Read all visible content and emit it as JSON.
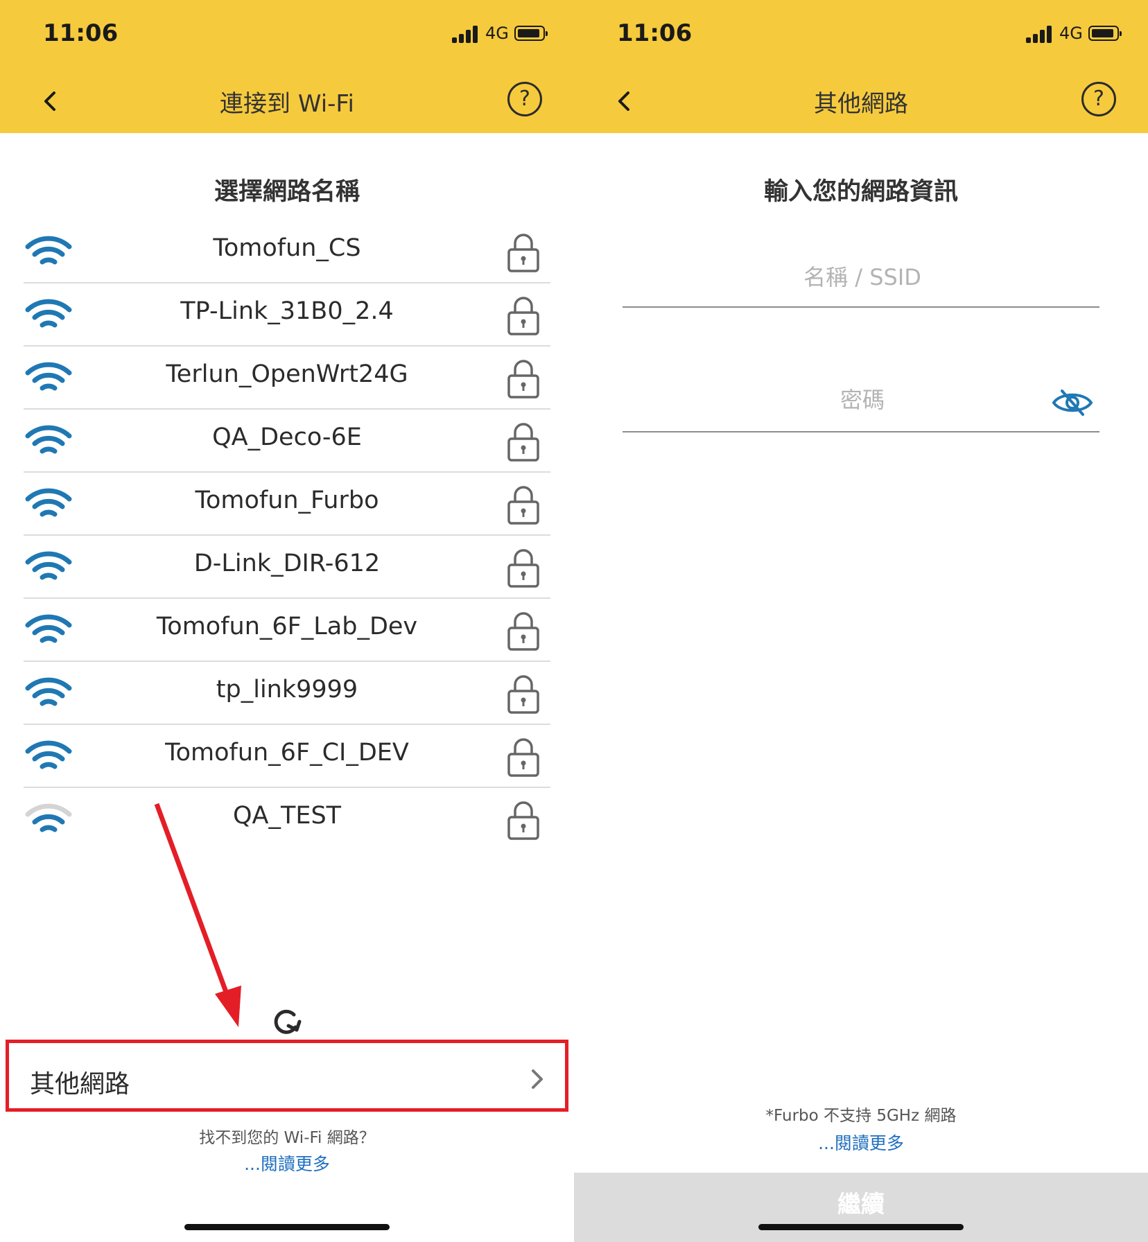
{
  "left": {
    "status": {
      "time": "11:06",
      "network": "4G"
    },
    "nav": {
      "title": "連接到 Wi-Fi",
      "help_label": "?"
    },
    "subtitle": "選擇網路名稱",
    "networks": [
      {
        "name": "Tomofun_CS",
        "signal": "strong",
        "locked": true
      },
      {
        "name": "TP-Link_31B0_2.4",
        "signal": "strong",
        "locked": true
      },
      {
        "name": "Terlun_OpenWrt24G",
        "signal": "strong",
        "locked": true
      },
      {
        "name": "QA_Deco-6E",
        "signal": "strong",
        "locked": true
      },
      {
        "name": "Tomofun_Furbo",
        "signal": "strong",
        "locked": true
      },
      {
        "name": "D-Link_DIR-612",
        "signal": "strong",
        "locked": true
      },
      {
        "name": "Tomofun_6F_Lab_Dev",
        "signal": "strong",
        "locked": true
      },
      {
        "name": "tp_link9999",
        "signal": "strong",
        "locked": true
      },
      {
        "name": "Tomofun_6F_CI_DEV",
        "signal": "strong",
        "locked": true
      },
      {
        "name": "QA_TEST",
        "signal": "medium",
        "locked": true
      }
    ],
    "other_network": "其他網路",
    "hint": "找不到您的 Wi-Fi 網路？",
    "read_more": "...閱讀更多"
  },
  "right": {
    "status": {
      "time": "11:06",
      "network": "4G"
    },
    "nav": {
      "title": "其他網路",
      "help_label": "?"
    },
    "subtitle": "輸入您的網路資訊",
    "ssid": {
      "value": "",
      "placeholder": "名稱 / SSID"
    },
    "password": {
      "value": "",
      "placeholder": "密碼"
    },
    "note": "*Furbo 不支持 5GHz 網路",
    "read_more": "...閱讀更多",
    "continue_label": "繼續"
  },
  "colors": {
    "header": "#f6ca3d",
    "wifi": "#1f78b4",
    "wifi_dim": "#d4d4d4",
    "highlight": "#e41e26",
    "link": "#1f6fbf",
    "button_disabled": "#dcdcdc"
  },
  "icons": {
    "back": "chevron-left-icon",
    "help": "question-circle-icon",
    "wifi": "wifi-icon",
    "lock": "lock-icon",
    "refresh": "refresh-icon",
    "chevron": "chevron-right-icon",
    "eye": "eye-slash-icon"
  }
}
